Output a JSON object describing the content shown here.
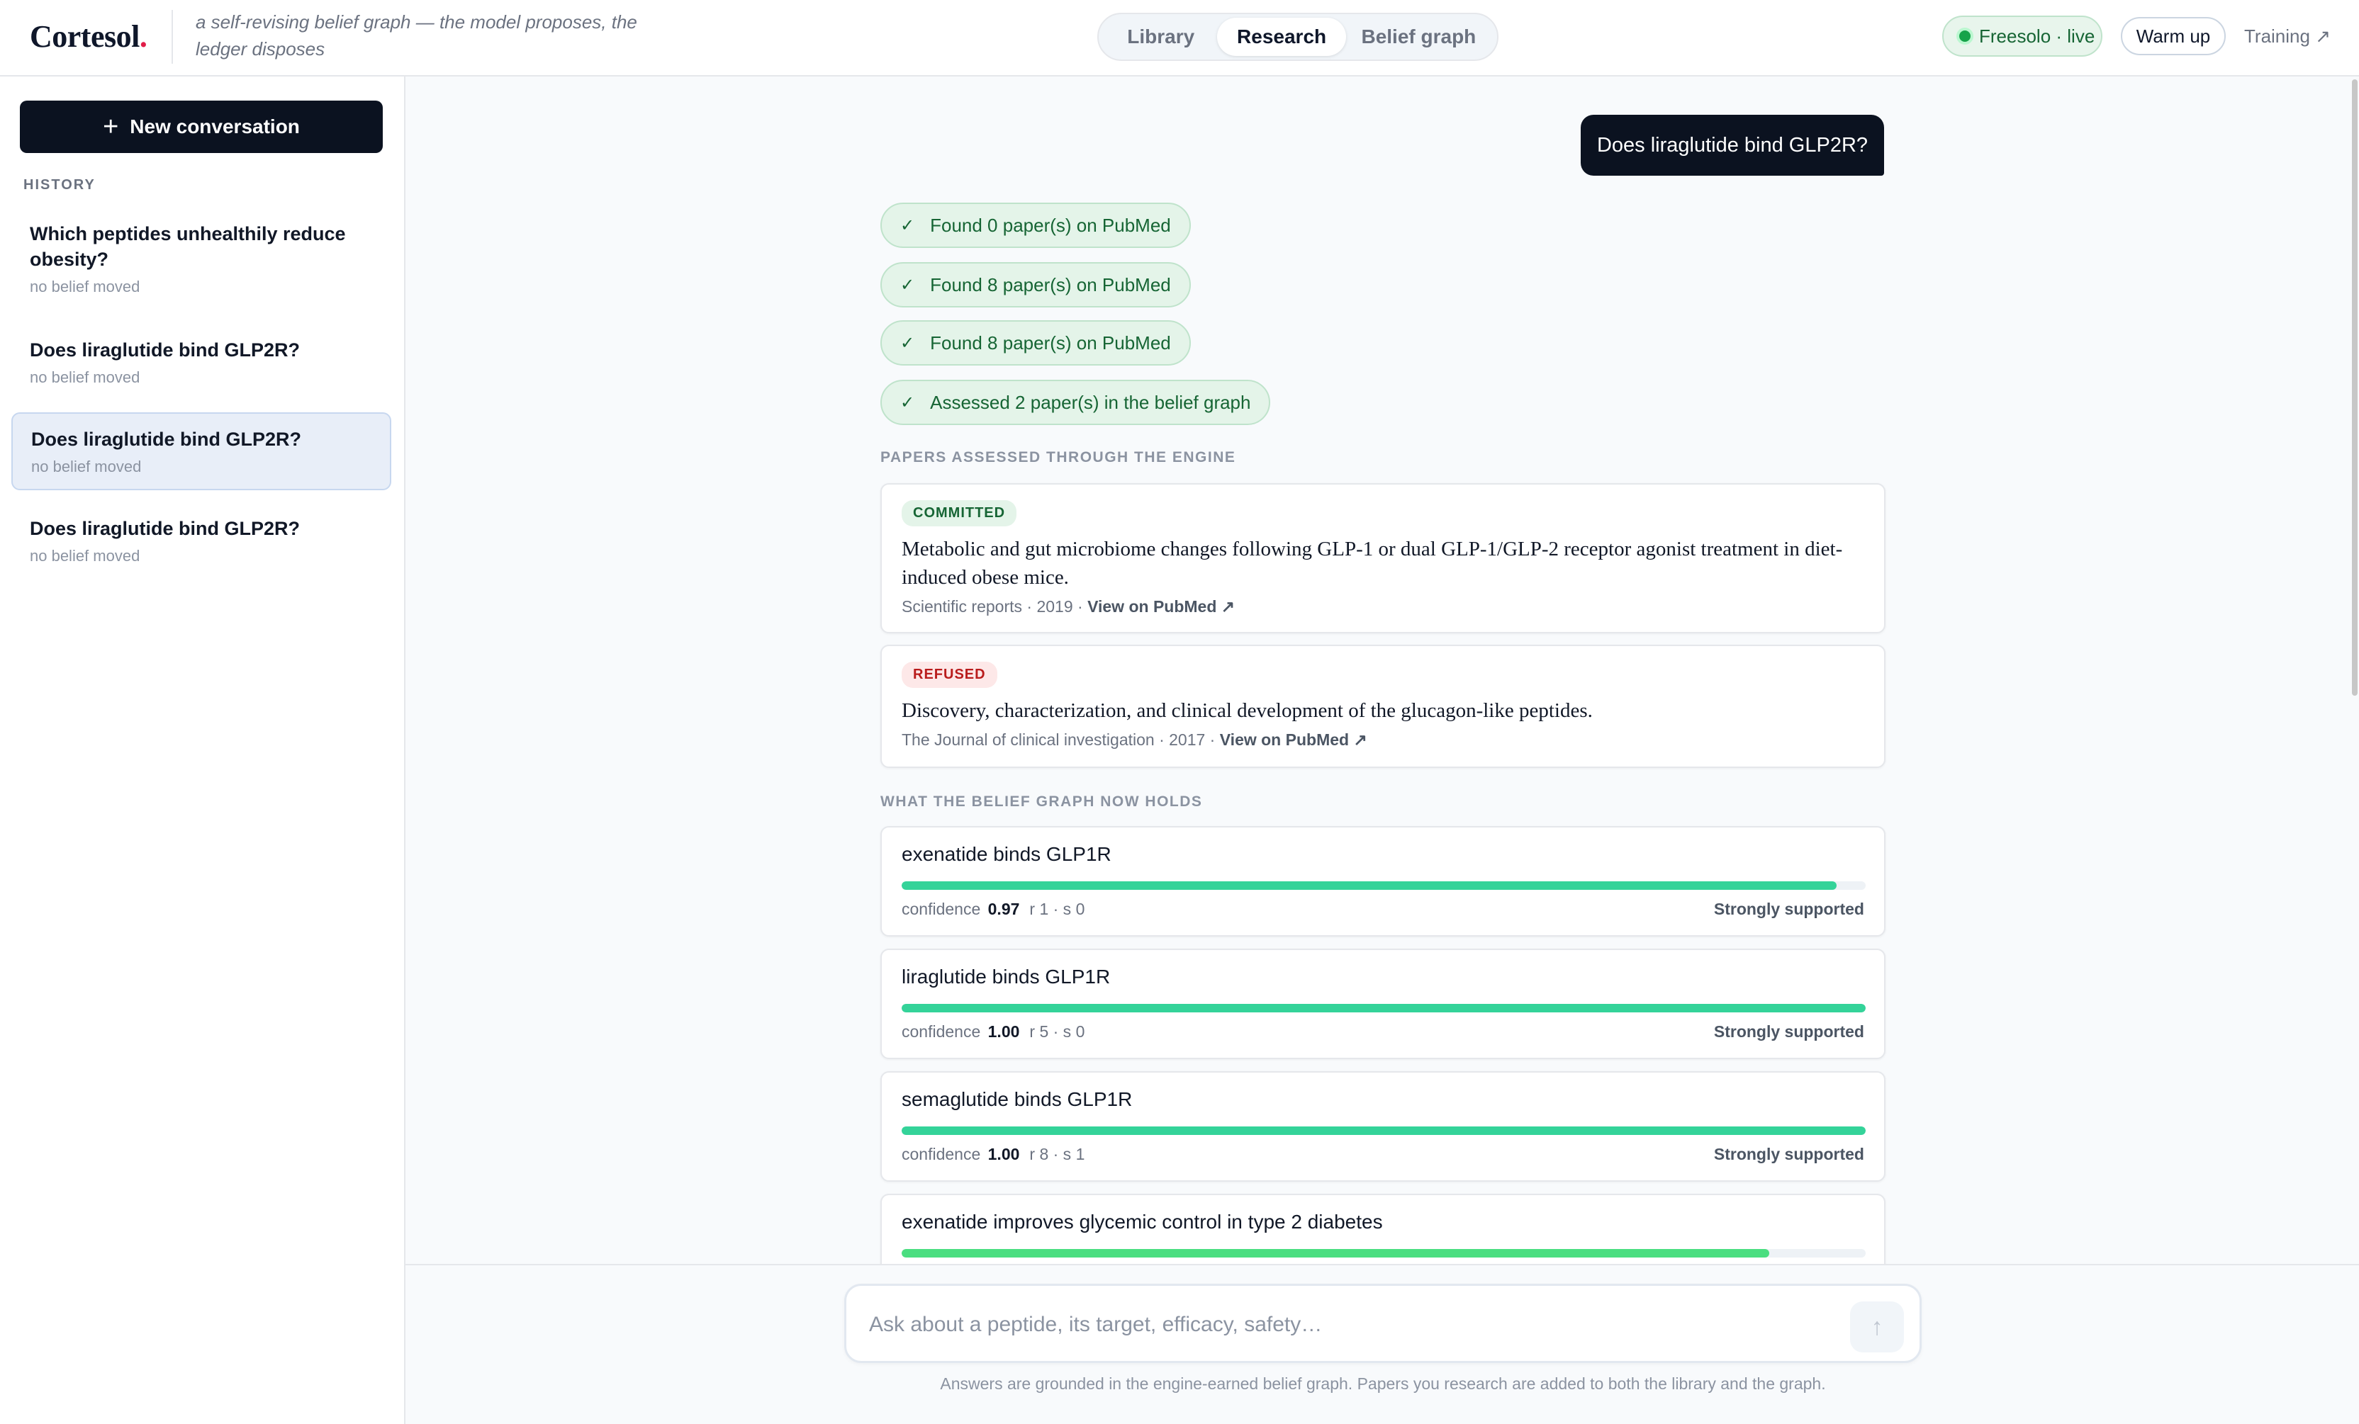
{
  "header": {
    "brand": "Cortesol",
    "brand_dot": ".",
    "tagline": "a self-revising belief graph — the model proposes, the ledger disposes",
    "tabs": [
      {
        "label": "Library"
      },
      {
        "label": "Research"
      },
      {
        "label": "Belief graph"
      }
    ],
    "active_tab": "Research",
    "status": "Freesolo · live",
    "warm_up_label": "Warm up",
    "training_label": "Training ↗",
    "colors": {
      "accent_dot": "#e11d48",
      "live": "#16a34a"
    }
  },
  "sidebar": {
    "new_conversation_label": "New conversation",
    "history_label": "HISTORY",
    "items": [
      {
        "title": "Which peptides unhealthily reduce obesity?",
        "subtitle": "no belief moved"
      },
      {
        "title": "Does liraglutide bind GLP2R?",
        "subtitle": "no belief moved"
      },
      {
        "title": "Does liraglutide bind GLP2R?",
        "subtitle": "no belief moved"
      },
      {
        "title": "Does liraglutide bind GLP2R?",
        "subtitle": "no belief moved"
      }
    ]
  },
  "chat": {
    "user_message": "Does liraglutide bind GLP2R?",
    "steps": [
      {
        "check": "✓",
        "text": "Found 0 paper(s) on PubMed"
      },
      {
        "check": "✓",
        "text": "Found 8 paper(s) on PubMed"
      },
      {
        "check": "✓",
        "text": "Found 8 paper(s) on PubMed"
      },
      {
        "check": "✓",
        "text": "Assessed 2 paper(s) in the belief graph"
      }
    ],
    "papers_label": "PAPERS ASSESSED THROUGH THE ENGINE",
    "papers": [
      {
        "status": "COMMITTED",
        "title": "Metabolic and gut microbiome changes following GLP-1 or dual GLP-1/GLP-2 receptor agonist treatment in diet-induced obese mice.",
        "journal_year": "Scientific reports · 2019 · ",
        "link": "View on PubMed ↗"
      },
      {
        "status": "REFUSED",
        "title": "Discovery, characterization, and clinical development of the glucagon-like peptides.",
        "journal_year": "The Journal of clinical investigation · 2017 · ",
        "link": "View on PubMed ↗"
      }
    ],
    "beliefs_label": "WHAT THE BELIEF GRAPH NOW HOLDS",
    "beliefs": [
      {
        "claim": "exenatide binds GLP1R",
        "conf_label": "confidence",
        "confidence": "0.97",
        "confidence_value": 0.97,
        "counts": "r 1 · s 0",
        "verdict": "Strongly supported"
      },
      {
        "claim": "liraglutide binds GLP1R",
        "conf_label": "confidence",
        "confidence": "1.00",
        "confidence_value": 1.0,
        "counts": "r 5 · s 0",
        "verdict": "Strongly supported"
      },
      {
        "claim": "semaglutide binds GLP1R",
        "conf_label": "confidence",
        "confidence": "1.00",
        "confidence_value": 1.0,
        "counts": "r 8 · s 1",
        "verdict": "Strongly supported"
      },
      {
        "claim": "exenatide improves glycemic control in type 2 diabetes",
        "confidence_value": 0.9
      }
    ]
  },
  "composer": {
    "placeholder": "Ask about a peptide, its target, efficacy, safety…",
    "value": "",
    "send_icon": "arrow-up-icon",
    "footnote": "Answers are grounded in the engine-earned belief graph. Papers you research are added to both the library and the graph."
  }
}
